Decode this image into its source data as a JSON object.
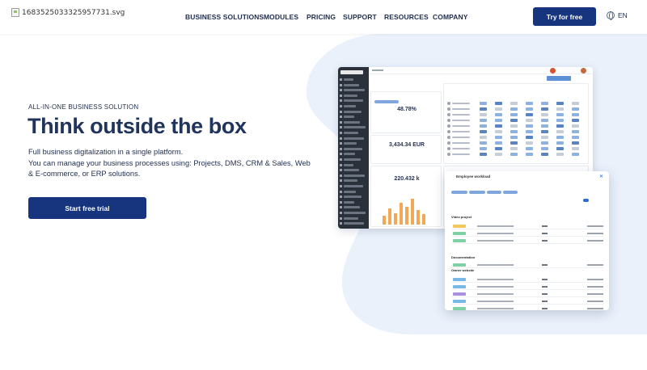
{
  "header": {
    "logo_alt": "1683525033325957731.svg",
    "nav": [
      "BUSINESS SOLUTIONS",
      "MODULES",
      "PRICING",
      "SUPPORT",
      "RESOURCES",
      "COMPANY"
    ],
    "cta": "Try for free",
    "language": "EN",
    "language_icon": "globe-icon"
  },
  "hero": {
    "eyebrow": "ALL-IN-ONE BUSINESS SOLUTION",
    "headline": "Think outside the box",
    "subtitle": "Full business digitalization in a single platform.",
    "description": "You can manage your business processes using: Projects, DMS, CRM & Sales, Web & E-commerce, or ERP solutions.",
    "cta": "Start free trial"
  },
  "dashboard": {
    "kpis": [
      {
        "value": "48.78%"
      },
      {
        "value": "3,434.34 EUR"
      },
      {
        "value": "220.432 k"
      }
    ],
    "bar_heights_pct": [
      30,
      55,
      40,
      75,
      60,
      90,
      50,
      35
    ]
  },
  "workload": {
    "title": "Employee workload",
    "sections": [
      "Video project",
      "Documentation",
      "Owner website"
    ]
  },
  "colors": {
    "brand": "#17357f",
    "blob": "#eaf1fb",
    "text": "#1f2d4d"
  }
}
